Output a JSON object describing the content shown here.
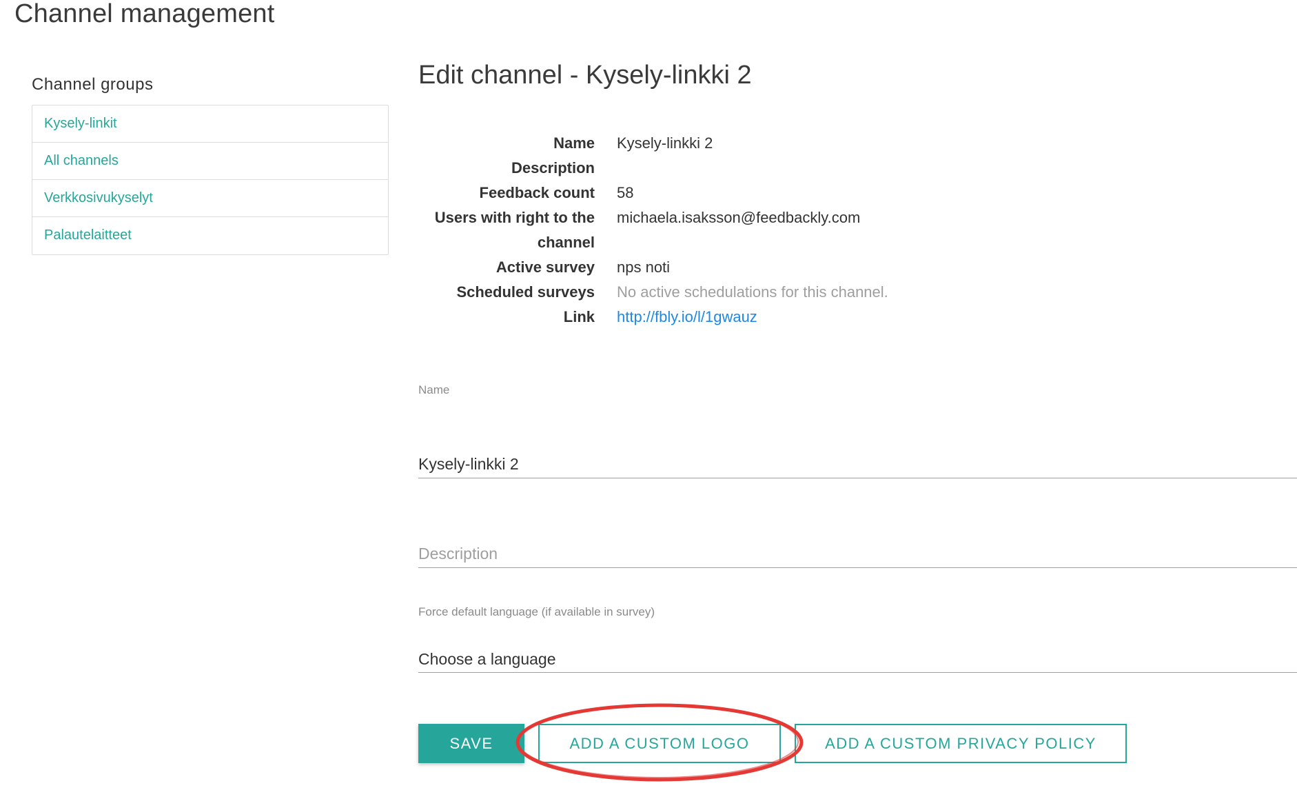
{
  "page": {
    "title": "Channel management"
  },
  "sidebar": {
    "title": "Channel groups",
    "items": [
      {
        "label": "Kysely-linkit"
      },
      {
        "label": "All channels"
      },
      {
        "label": "Verkkosivukyselyt"
      },
      {
        "label": "Palautelaitteet"
      }
    ]
  },
  "edit": {
    "title": "Edit channel - Kysely-linkki 2",
    "details": [
      {
        "label": "Name",
        "value": "Kysely-linkki 2"
      },
      {
        "label": "Description",
        "value": ""
      },
      {
        "label": "Feedback count",
        "value": "58"
      },
      {
        "label": "Users with right to the",
        "value": "michaela.isaksson@feedbackly.com"
      },
      {
        "label": "channel",
        "value": ""
      },
      {
        "label": "Active survey",
        "value": "nps noti"
      },
      {
        "label": "Scheduled surveys",
        "value": "No active schedulations for this channel."
      },
      {
        "label": "Link",
        "value": "http://fbly.io/l/1gwauz"
      }
    ]
  },
  "form": {
    "name_label": "Name",
    "name_value": "Kysely-linkki 2",
    "description_placeholder": "Description",
    "language_label": "Force default language (if available in survey)",
    "language_value": "Choose a language"
  },
  "buttons": {
    "save": "SAVE",
    "custom_logo": "ADD A CUSTOM LOGO",
    "privacy_policy": "ADD A CUSTOM PRIVACY POLICY"
  },
  "colors": {
    "accent": "#26a69a",
    "link": "#1e88e5",
    "annotation": "#e53935"
  }
}
